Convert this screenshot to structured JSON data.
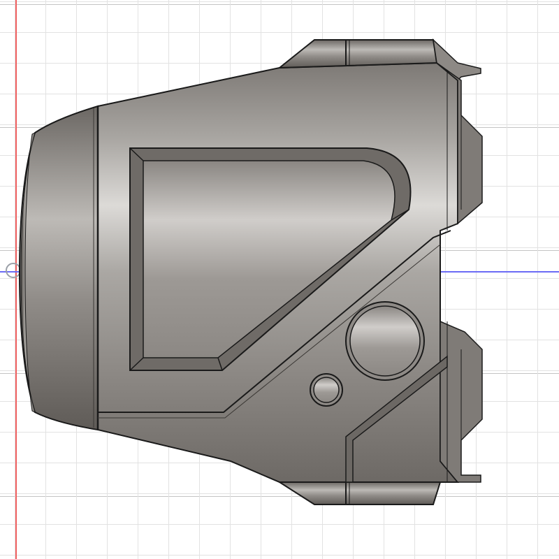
{
  "viewport": {
    "view_type": "orthographic",
    "grid": true
  },
  "axes": {
    "vertical_axis_color": "#f06060",
    "horizontal_axis_color": "#6b6bf5",
    "origin_marker_color": "#9ba0a8"
  },
  "model": {
    "body_color": "#8f8b87",
    "highlight_color": "#d6d3d0",
    "shadow_color": "#5e5a56",
    "edge_color": "#1a1a1a"
  }
}
